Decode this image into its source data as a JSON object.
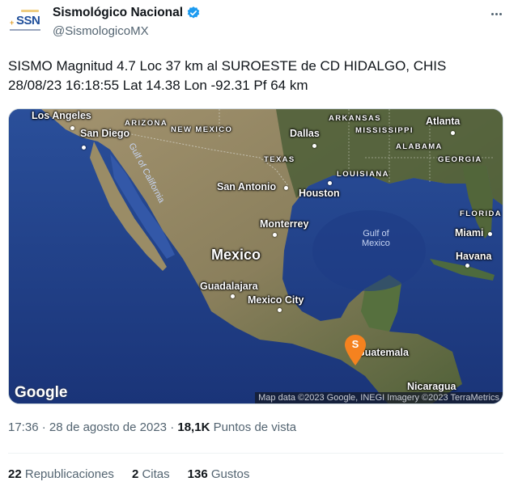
{
  "account": {
    "display_name": "Sismológico Nacional",
    "handle": "@SismologicoMX",
    "avatar_text": "SSN",
    "verified": true,
    "verified_color": "#1d9bf0"
  },
  "menu_icon": "more-horizontal-icon",
  "tweet": {
    "line1": "SISMO Magnitud 4.7 Loc 37 km al SUROESTE de CD HIDALGO, CHIS",
    "line2": "28/08/23 16:18:55 Lat 14.38 Lon -92.31 Pf 64 km"
  },
  "map": {
    "labels": {
      "los_angeles": "Los Angeles",
      "san_diego": "San Diego",
      "arizona": "ARIZONA",
      "new_mexico": "NEW MEXICO",
      "dallas": "Dallas",
      "arkansas": "ARKANSAS",
      "mississippi": "MISSISSIPPI",
      "atlanta": "Atlanta",
      "alabama": "ALABAMA",
      "georgia": "GEORGIA",
      "texas": "TEXAS",
      "louisiana": "LOUISIANA",
      "san_antonio": "San Antonio",
      "houston": "Houston",
      "gulf_of_california": "Gulf of California",
      "florida": "FLORIDA",
      "monterrey": "Monterrey",
      "gulf_of_mexico_1": "Gulf of",
      "gulf_of_mexico_2": "Mexico",
      "miami": "Miami",
      "mexico": "Mexico",
      "havana": "Havana",
      "guadalajara": "Guadalajara",
      "mexico_city": "Mexico City",
      "guatemala": "Guatemala",
      "nicaragua": "Nicaragua"
    },
    "marker_label": "S",
    "marker_color": "#f5821f",
    "google_logo": "Google",
    "attribution": "Map data ©2023 Google, INEGI Imagery ©2023 TerraMetrics"
  },
  "meta": {
    "time": "17:36",
    "date": "28 de agosto de 2023",
    "views_count": "18,1K",
    "views_label": "Puntos de vista"
  },
  "stats": [
    {
      "count": "22",
      "label": "Republicaciones"
    },
    {
      "count": "2",
      "label": "Citas"
    },
    {
      "count": "136",
      "label": "Gustos"
    }
  ]
}
